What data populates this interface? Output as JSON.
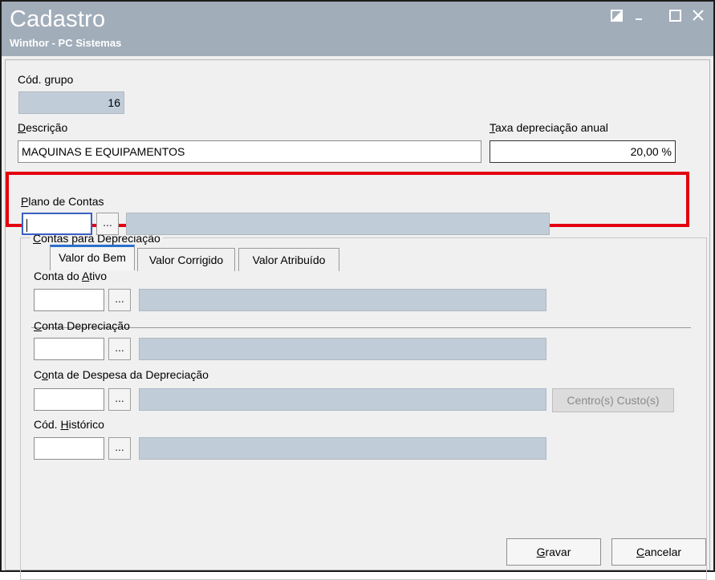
{
  "window": {
    "title": "Cadastro",
    "subtitle": "Winthor - PC Sistemas"
  },
  "form": {
    "cod_grupo": {
      "label": "Cód. grupo",
      "value": "16"
    },
    "descricao": {
      "label_prefix": "D",
      "label_rest": "escrição",
      "value": "MAQUINAS E EQUIPAMENTOS"
    },
    "taxa": {
      "label_prefix": "T",
      "label_rest": "axa depreciação anual",
      "value": "20,00 %"
    }
  },
  "contas": {
    "group_label_prefix": "C",
    "group_label_rest": "ontas para Depreciação",
    "plano": {
      "label_prefix": "P",
      "label_rest": "lano de Contas",
      "lookup_label": "..."
    }
  },
  "tabs": [
    {
      "label": "Valor do Bem",
      "active": true
    },
    {
      "label": "Valor Corrigido",
      "active": false
    },
    {
      "label": "Valor Atribuído",
      "active": false
    }
  ],
  "tab_fields": {
    "conta_ativo": {
      "label_a": "Conta do ",
      "label_u": "A",
      "label_b": "tivo"
    },
    "conta_depreciacao": {
      "label_a": "",
      "label_u": "C",
      "label_b": "onta Depreciação"
    },
    "conta_despesa": {
      "label_a": "C",
      "label_u": "o",
      "label_b": "nta de Despesa da Depreciação"
    },
    "cod_historico": {
      "label_a": "Cód. ",
      "label_u": "H",
      "label_b": "istórico"
    },
    "lookup_label": "...",
    "centro_custo_label": "Centro(s) Custo(s)"
  },
  "buttons": {
    "gravar_prefix": "G",
    "gravar_rest": "ravar",
    "cancelar_prefix": "C",
    "cancelar_rest": "ancelar"
  },
  "colors": {
    "titlebar": "#a2adba",
    "highlight": "#e3000f",
    "readonly_field": "#c0cdd9",
    "active_tab": "#2b6fce"
  }
}
